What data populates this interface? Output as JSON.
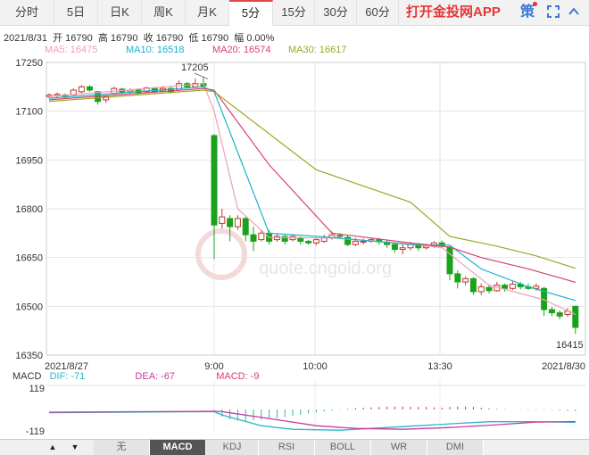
{
  "tabs": [
    {
      "label": "分时",
      "active": false
    },
    {
      "label": "5日",
      "active": false
    },
    {
      "label": "日K",
      "active": false
    },
    {
      "label": "周K",
      "active": false
    },
    {
      "label": "月K",
      "active": false
    },
    {
      "label": "5分",
      "active": true
    },
    {
      "label": "15分",
      "active": false
    },
    {
      "label": "30分",
      "active": false
    },
    {
      "label": "60分",
      "active": false
    }
  ],
  "promo": "打开金投网APP",
  "policy_label": "策",
  "info": {
    "date": "2021/8/31",
    "open_label": "开",
    "open": "16790",
    "high_label": "高",
    "high": "16790",
    "close_label": "收",
    "close": "16790",
    "low_label": "低",
    "low": "16790",
    "amp_label": "幅",
    "amp": "0.00%"
  },
  "ma": [
    {
      "label": "MA5: 16475",
      "color": "#f0a0b8"
    },
    {
      "label": "MA10: 16518",
      "color": "#1ab3cc"
    },
    {
      "label": "MA20: 16574",
      "color": "#d9406a"
    },
    {
      "label": "MA30: 16617",
      "color": "#9aa824"
    }
  ],
  "watermark": "quote.cngold.org",
  "macd_legend": {
    "title": "MACD",
    "dif": "DIF: -71",
    "dif_color": "#2bb5c9",
    "dea": "DEA: -67",
    "dea_color": "#c93aa3",
    "macd": "MACD: -9",
    "macd_color": "#d9406a"
  },
  "indicator_tabs": [
    {
      "label": "无",
      "active": false
    },
    {
      "label": "MACD",
      "active": true
    },
    {
      "label": "KDJ",
      "active": false
    },
    {
      "label": "RSI",
      "active": false
    },
    {
      "label": "BOLL",
      "active": false
    },
    {
      "label": "WR",
      "active": false
    },
    {
      "label": "DMI",
      "active": false
    }
  ],
  "nav": {
    "up": "▲",
    "down": "▼"
  },
  "chart_data": {
    "type": "candlestick",
    "ylim": [
      16350,
      17250
    ],
    "yticks": [
      "17250",
      "17100",
      "16950",
      "16800",
      "16650",
      "16500",
      "16350"
    ],
    "xticks": [
      "2021/8/27",
      "9:00",
      "10:00",
      "13:30",
      "2021/8/30"
    ],
    "annotations": [
      {
        "label": "17205",
        "value": 17205
      },
      {
        "label": "16415",
        "value": 16415
      }
    ],
    "candles": [
      {
        "o": 17145,
        "c": 17150,
        "h": 17155,
        "l": 17140
      },
      {
        "o": 17148,
        "c": 17152,
        "h": 17158,
        "l": 17142
      },
      {
        "o": 17150,
        "c": 17145,
        "h": 17155,
        "l": 17138
      },
      {
        "o": 17150,
        "c": 17165,
        "h": 17170,
        "l": 17148
      },
      {
        "o": 17160,
        "c": 17175,
        "h": 17180,
        "l": 17155
      },
      {
        "o": 17175,
        "c": 17165,
        "h": 17180,
        "l": 17160
      },
      {
        "o": 17160,
        "c": 17130,
        "h": 17162,
        "l": 17120
      },
      {
        "o": 17135,
        "c": 17145,
        "h": 17150,
        "l": 17125
      },
      {
        "o": 17155,
        "c": 17170,
        "h": 17175,
        "l": 17150
      },
      {
        "o": 17168,
        "c": 17158,
        "h": 17172,
        "l": 17150
      },
      {
        "o": 17160,
        "c": 17165,
        "h": 17170,
        "l": 17152
      },
      {
        "o": 17165,
        "c": 17158,
        "h": 17170,
        "l": 17150
      },
      {
        "o": 17160,
        "c": 17172,
        "h": 17175,
        "l": 17155
      },
      {
        "o": 17170,
        "c": 17160,
        "h": 17175,
        "l": 17155
      },
      {
        "o": 17162,
        "c": 17170,
        "h": 17178,
        "l": 17158
      },
      {
        "o": 17170,
        "c": 17160,
        "h": 17175,
        "l": 17155
      },
      {
        "o": 17165,
        "c": 17185,
        "h": 17195,
        "l": 17160
      },
      {
        "o": 17185,
        "c": 17175,
        "h": 17190,
        "l": 17170
      },
      {
        "o": 17175,
        "c": 17185,
        "h": 17200,
        "l": 17172
      },
      {
        "o": 17185,
        "c": 17178,
        "h": 17205,
        "l": 17172
      },
      {
        "o": 17025,
        "c": 16750,
        "h": 17030,
        "l": 16645
      },
      {
        "o": 16755,
        "c": 16775,
        "h": 16800,
        "l": 16740
      },
      {
        "o": 16770,
        "c": 16745,
        "h": 16780,
        "l": 16700
      },
      {
        "o": 16745,
        "c": 16770,
        "h": 16780,
        "l": 16735
      },
      {
        "o": 16770,
        "c": 16720,
        "h": 16775,
        "l": 16700
      },
      {
        "o": 16720,
        "c": 16700,
        "h": 16745,
        "l": 16670
      },
      {
        "o": 16705,
        "c": 16725,
        "h": 16735,
        "l": 16700
      },
      {
        "o": 16725,
        "c": 16700,
        "h": 16735,
        "l": 16690
      },
      {
        "o": 16705,
        "c": 16715,
        "h": 16722,
        "l": 16698
      },
      {
        "o": 16715,
        "c": 16700,
        "h": 16720,
        "l": 16690
      },
      {
        "o": 16705,
        "c": 16715,
        "h": 16722,
        "l": 16700
      },
      {
        "o": 16710,
        "c": 16700,
        "h": 16715,
        "l": 16690
      },
      {
        "o": 16700,
        "c": 16695,
        "h": 16705,
        "l": 16690
      },
      {
        "o": 16695,
        "c": 16705,
        "h": 16710,
        "l": 16688
      },
      {
        "o": 16700,
        "c": 16710,
        "h": 16720,
        "l": 16695
      },
      {
        "o": 16710,
        "c": 16720,
        "h": 16730,
        "l": 16705
      },
      {
        "o": 16718,
        "c": 16715,
        "h": 16725,
        "l": 16710
      },
      {
        "o": 16712,
        "c": 16690,
        "h": 16720,
        "l": 16685
      },
      {
        "o": 16690,
        "c": 16700,
        "h": 16710,
        "l": 16685
      },
      {
        "o": 16698,
        "c": 16700,
        "h": 16708,
        "l": 16690
      },
      {
        "o": 16700,
        "c": 16705,
        "h": 16712,
        "l": 16695
      },
      {
        "o": 16705,
        "c": 16698,
        "h": 16710,
        "l": 16690
      },
      {
        "o": 16698,
        "c": 16690,
        "h": 16705,
        "l": 16680
      },
      {
        "o": 16690,
        "c": 16675,
        "h": 16695,
        "l": 16665
      },
      {
        "o": 16675,
        "c": 16680,
        "h": 16690,
        "l": 16660
      },
      {
        "o": 16680,
        "c": 16690,
        "h": 16698,
        "l": 16672
      },
      {
        "o": 16690,
        "c": 16680,
        "h": 16695,
        "l": 16670
      },
      {
        "o": 16680,
        "c": 16685,
        "h": 16692,
        "l": 16675
      },
      {
        "o": 16685,
        "c": 16695,
        "h": 16700,
        "l": 16680
      },
      {
        "o": 16695,
        "c": 16685,
        "h": 16702,
        "l": 16678
      },
      {
        "o": 16680,
        "c": 16600,
        "h": 16685,
        "l": 16580
      },
      {
        "o": 16600,
        "c": 16575,
        "h": 16610,
        "l": 16555
      },
      {
        "o": 16575,
        "c": 16585,
        "h": 16592,
        "l": 16565
      },
      {
        "o": 16585,
        "c": 16545,
        "h": 16590,
        "l": 16535
      },
      {
        "o": 16545,
        "c": 16560,
        "h": 16570,
        "l": 16535
      },
      {
        "o": 16558,
        "c": 16548,
        "h": 16565,
        "l": 16540
      },
      {
        "o": 16548,
        "c": 16565,
        "h": 16575,
        "l": 16545
      },
      {
        "o": 16565,
        "c": 16555,
        "h": 16570,
        "l": 16545
      },
      {
        "o": 16555,
        "c": 16568,
        "h": 16578,
        "l": 16550
      },
      {
        "o": 16568,
        "c": 16560,
        "h": 16575,
        "l": 16552
      },
      {
        "o": 16560,
        "c": 16555,
        "h": 16570,
        "l": 16550
      },
      {
        "o": 16555,
        "c": 16562,
        "h": 16570,
        "l": 16548
      },
      {
        "o": 16555,
        "c": 16490,
        "h": 16560,
        "l": 16470
      },
      {
        "o": 16490,
        "c": 16480,
        "h": 16498,
        "l": 16470
      },
      {
        "o": 16480,
        "c": 16470,
        "h": 16488,
        "l": 16460
      },
      {
        "o": 16475,
        "c": 16485,
        "h": 16495,
        "l": 16468
      },
      {
        "o": 16500,
        "c": 16435,
        "h": 16502,
        "l": 16415
      }
    ],
    "series": [
      {
        "name": "MA5",
        "color": "#f0a0b8",
        "breaks": [
          [
            0,
            17145
          ],
          [
            19,
            17185
          ],
          [
            20,
            17100
          ],
          [
            23,
            16800
          ],
          [
            27,
            16712
          ],
          [
            35,
            16710
          ],
          [
            45,
            16692
          ],
          [
            49,
            16680
          ],
          [
            55,
            16565
          ],
          [
            62,
            16520
          ],
          [
            66,
            16475
          ]
        ]
      },
      {
        "name": "MA10",
        "color": "#1ab3cc",
        "breaks": [
          [
            0,
            17140
          ],
          [
            19,
            17175
          ],
          [
            20,
            17160
          ],
          [
            27,
            16725
          ],
          [
            35,
            16712
          ],
          [
            45,
            16690
          ],
          [
            50,
            16688
          ],
          [
            54,
            16615
          ],
          [
            60,
            16560
          ],
          [
            66,
            16518
          ]
        ]
      },
      {
        "name": "MA20",
        "color": "#d9406a",
        "breaks": [
          [
            0,
            17135
          ],
          [
            19,
            17170
          ],
          [
            20,
            17165
          ],
          [
            27,
            16935
          ],
          [
            35,
            16725
          ],
          [
            45,
            16695
          ],
          [
            50,
            16682
          ],
          [
            54,
            16650
          ],
          [
            60,
            16615
          ],
          [
            66,
            16574
          ]
        ]
      },
      {
        "name": "MA30",
        "color": "#9aa824",
        "breaks": [
          [
            0,
            17130
          ],
          [
            19,
            17165
          ],
          [
            20,
            17160
          ],
          [
            33,
            16920
          ],
          [
            45,
            16820
          ],
          [
            50,
            16715
          ],
          [
            56,
            16685
          ],
          [
            61,
            16655
          ],
          [
            66,
            16617
          ]
        ]
      }
    ],
    "macd": {
      "ylim": [
        -119,
        119
      ],
      "yticks": [
        "119",
        "-119"
      ],
      "dif": [
        [
          0,
          -18
        ],
        [
          20,
          -12
        ],
        [
          21,
          -30
        ],
        [
          26,
          -90
        ],
        [
          30,
          -110
        ],
        [
          36,
          -115
        ],
        [
          44,
          -95
        ],
        [
          50,
          -80
        ],
        [
          55,
          -68
        ],
        [
          60,
          -68
        ],
        [
          66,
          -71
        ]
      ],
      "dea": [
        [
          0,
          -15
        ],
        [
          20,
          -10
        ],
        [
          21,
          -12
        ],
        [
          27,
          -50
        ],
        [
          33,
          -90
        ],
        [
          38,
          -105
        ],
        [
          44,
          -110
        ],
        [
          50,
          -100
        ],
        [
          56,
          -85
        ],
        [
          61,
          -70
        ],
        [
          66,
          -67
        ]
      ],
      "hist": [
        0,
        0,
        0,
        0,
        0,
        0,
        0,
        0,
        0,
        0,
        0,
        0,
        0,
        0,
        0,
        0,
        0,
        0,
        0,
        0,
        -5,
        -40,
        -55,
        -62,
        -66,
        -60,
        -58,
        -52,
        -48,
        -42,
        -36,
        -30,
        -22,
        -16,
        -12,
        -6,
        -2,
        4,
        8,
        10,
        12,
        14,
        16,
        16,
        16,
        15,
        14,
        14,
        12,
        10,
        14,
        16,
        16,
        14,
        10,
        6,
        4,
        2,
        0,
        -2,
        -3,
        -3,
        -2,
        -4,
        -6,
        -8,
        -9
      ]
    }
  }
}
